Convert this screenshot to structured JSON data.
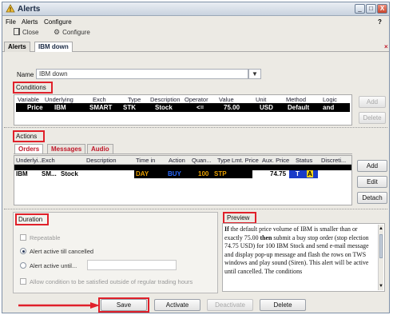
{
  "window": {
    "title": "Alerts",
    "controls": [
      "_",
      "□",
      "X"
    ]
  },
  "menu": {
    "file": "File",
    "alerts": "Alerts",
    "configure": "Configure",
    "help": "?"
  },
  "toolbar": {
    "close": "Close",
    "configure": "Configure"
  },
  "tabs": [
    "Alerts",
    "IBM down"
  ],
  "name_field": {
    "label": "Name",
    "value": "IBM down"
  },
  "conditions": {
    "label": "Conditions",
    "headers": [
      "Variable",
      "Underlying",
      "Exch",
      "Type",
      "Description",
      "Operator",
      "Value",
      "Unit",
      "Method",
      "Logic"
    ],
    "row": [
      "Price",
      "IBM",
      "SMART",
      "STK",
      "Stock",
      "<=",
      "75.00",
      "USD",
      "Default",
      "and"
    ],
    "add": "Add",
    "delete": "Delete"
  },
  "actions": {
    "label": "Actions",
    "tabs": [
      "Orders",
      "Messages",
      "Audio"
    ],
    "headers": [
      "Underlyi...",
      "Exch",
      "Description",
      "Time in",
      "Action",
      "Quan...",
      "Type",
      "Lmt. Price",
      "Aux. Price",
      "Status",
      "Discreti..."
    ],
    "row": [
      "IBM",
      "SM...",
      "Stock",
      "DAY",
      "BUY",
      "100",
      "STP",
      "",
      "74.75",
      "T",
      "A"
    ],
    "add": "Add",
    "edit": "Edit",
    "detach": "Detach"
  },
  "duration": {
    "label": "Duration",
    "repeatable": "Repeatable",
    "active_till_cancelled": "Alert active till cancelled",
    "active_until": "Alert active until...",
    "allow_outside": "Allow condition to be satisfied outside of regular trading hours"
  },
  "preview": {
    "label": "Preview",
    "text_1": "If",
    "text_2": " the default price volume of IBM is smaller than or exactly 75.00 ",
    "text_3": "then",
    "text_4": " submit a buy stop order (stop election 74.75 USD) for 100 IBM Stock and send e-mail message and display pop-up message and flash the rows on TWS windows and play sound (Siren). This alert will be active until cancelled. The conditions"
  },
  "footer": {
    "save": "Save",
    "activate": "Activate",
    "deactivate": "Deactivate",
    "delete": "Delete"
  },
  "colors": {
    "highlight_red": "#e0202a",
    "arrow_red": "#e0202a",
    "action_text": "#e8a000"
  }
}
